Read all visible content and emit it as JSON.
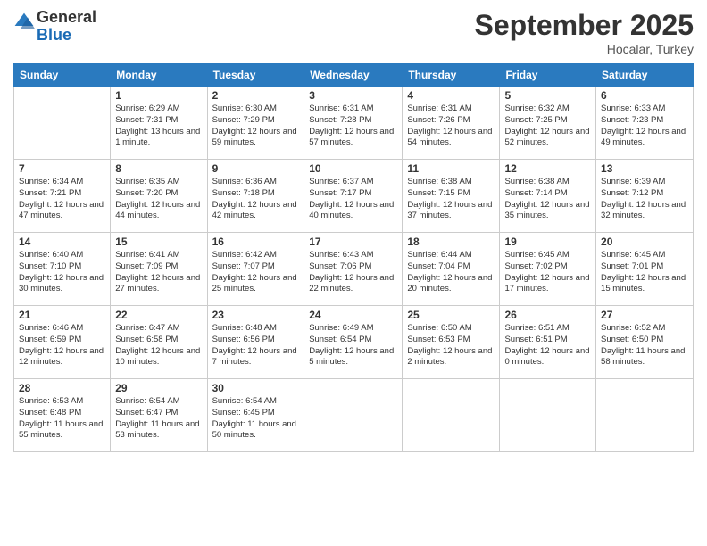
{
  "logo": {
    "line1": "General",
    "line2": "Blue"
  },
  "title": "September 2025",
  "subtitle": "Hocalar, Turkey",
  "days_of_week": [
    "Sunday",
    "Monday",
    "Tuesday",
    "Wednesday",
    "Thursday",
    "Friday",
    "Saturday"
  ],
  "weeks": [
    [
      {
        "num": "",
        "info": ""
      },
      {
        "num": "1",
        "info": "Sunrise: 6:29 AM\nSunset: 7:31 PM\nDaylight: 13 hours\nand 1 minute."
      },
      {
        "num": "2",
        "info": "Sunrise: 6:30 AM\nSunset: 7:29 PM\nDaylight: 12 hours\nand 59 minutes."
      },
      {
        "num": "3",
        "info": "Sunrise: 6:31 AM\nSunset: 7:28 PM\nDaylight: 12 hours\nand 57 minutes."
      },
      {
        "num": "4",
        "info": "Sunrise: 6:31 AM\nSunset: 7:26 PM\nDaylight: 12 hours\nand 54 minutes."
      },
      {
        "num": "5",
        "info": "Sunrise: 6:32 AM\nSunset: 7:25 PM\nDaylight: 12 hours\nand 52 minutes."
      },
      {
        "num": "6",
        "info": "Sunrise: 6:33 AM\nSunset: 7:23 PM\nDaylight: 12 hours\nand 49 minutes."
      }
    ],
    [
      {
        "num": "7",
        "info": "Sunrise: 6:34 AM\nSunset: 7:21 PM\nDaylight: 12 hours\nand 47 minutes."
      },
      {
        "num": "8",
        "info": "Sunrise: 6:35 AM\nSunset: 7:20 PM\nDaylight: 12 hours\nand 44 minutes."
      },
      {
        "num": "9",
        "info": "Sunrise: 6:36 AM\nSunset: 7:18 PM\nDaylight: 12 hours\nand 42 minutes."
      },
      {
        "num": "10",
        "info": "Sunrise: 6:37 AM\nSunset: 7:17 PM\nDaylight: 12 hours\nand 40 minutes."
      },
      {
        "num": "11",
        "info": "Sunrise: 6:38 AM\nSunset: 7:15 PM\nDaylight: 12 hours\nand 37 minutes."
      },
      {
        "num": "12",
        "info": "Sunrise: 6:38 AM\nSunset: 7:14 PM\nDaylight: 12 hours\nand 35 minutes."
      },
      {
        "num": "13",
        "info": "Sunrise: 6:39 AM\nSunset: 7:12 PM\nDaylight: 12 hours\nand 32 minutes."
      }
    ],
    [
      {
        "num": "14",
        "info": "Sunrise: 6:40 AM\nSunset: 7:10 PM\nDaylight: 12 hours\nand 30 minutes."
      },
      {
        "num": "15",
        "info": "Sunrise: 6:41 AM\nSunset: 7:09 PM\nDaylight: 12 hours\nand 27 minutes."
      },
      {
        "num": "16",
        "info": "Sunrise: 6:42 AM\nSunset: 7:07 PM\nDaylight: 12 hours\nand 25 minutes."
      },
      {
        "num": "17",
        "info": "Sunrise: 6:43 AM\nSunset: 7:06 PM\nDaylight: 12 hours\nand 22 minutes."
      },
      {
        "num": "18",
        "info": "Sunrise: 6:44 AM\nSunset: 7:04 PM\nDaylight: 12 hours\nand 20 minutes."
      },
      {
        "num": "19",
        "info": "Sunrise: 6:45 AM\nSunset: 7:02 PM\nDaylight: 12 hours\nand 17 minutes."
      },
      {
        "num": "20",
        "info": "Sunrise: 6:45 AM\nSunset: 7:01 PM\nDaylight: 12 hours\nand 15 minutes."
      }
    ],
    [
      {
        "num": "21",
        "info": "Sunrise: 6:46 AM\nSunset: 6:59 PM\nDaylight: 12 hours\nand 12 minutes."
      },
      {
        "num": "22",
        "info": "Sunrise: 6:47 AM\nSunset: 6:58 PM\nDaylight: 12 hours\nand 10 minutes."
      },
      {
        "num": "23",
        "info": "Sunrise: 6:48 AM\nSunset: 6:56 PM\nDaylight: 12 hours\nand 7 minutes."
      },
      {
        "num": "24",
        "info": "Sunrise: 6:49 AM\nSunset: 6:54 PM\nDaylight: 12 hours\nand 5 minutes."
      },
      {
        "num": "25",
        "info": "Sunrise: 6:50 AM\nSunset: 6:53 PM\nDaylight: 12 hours\nand 2 minutes."
      },
      {
        "num": "26",
        "info": "Sunrise: 6:51 AM\nSunset: 6:51 PM\nDaylight: 12 hours\nand 0 minutes."
      },
      {
        "num": "27",
        "info": "Sunrise: 6:52 AM\nSunset: 6:50 PM\nDaylight: 11 hours\nand 58 minutes."
      }
    ],
    [
      {
        "num": "28",
        "info": "Sunrise: 6:53 AM\nSunset: 6:48 PM\nDaylight: 11 hours\nand 55 minutes."
      },
      {
        "num": "29",
        "info": "Sunrise: 6:54 AM\nSunset: 6:47 PM\nDaylight: 11 hours\nand 53 minutes."
      },
      {
        "num": "30",
        "info": "Sunrise: 6:54 AM\nSunset: 6:45 PM\nDaylight: 11 hours\nand 50 minutes."
      },
      {
        "num": "",
        "info": ""
      },
      {
        "num": "",
        "info": ""
      },
      {
        "num": "",
        "info": ""
      },
      {
        "num": "",
        "info": ""
      }
    ]
  ]
}
